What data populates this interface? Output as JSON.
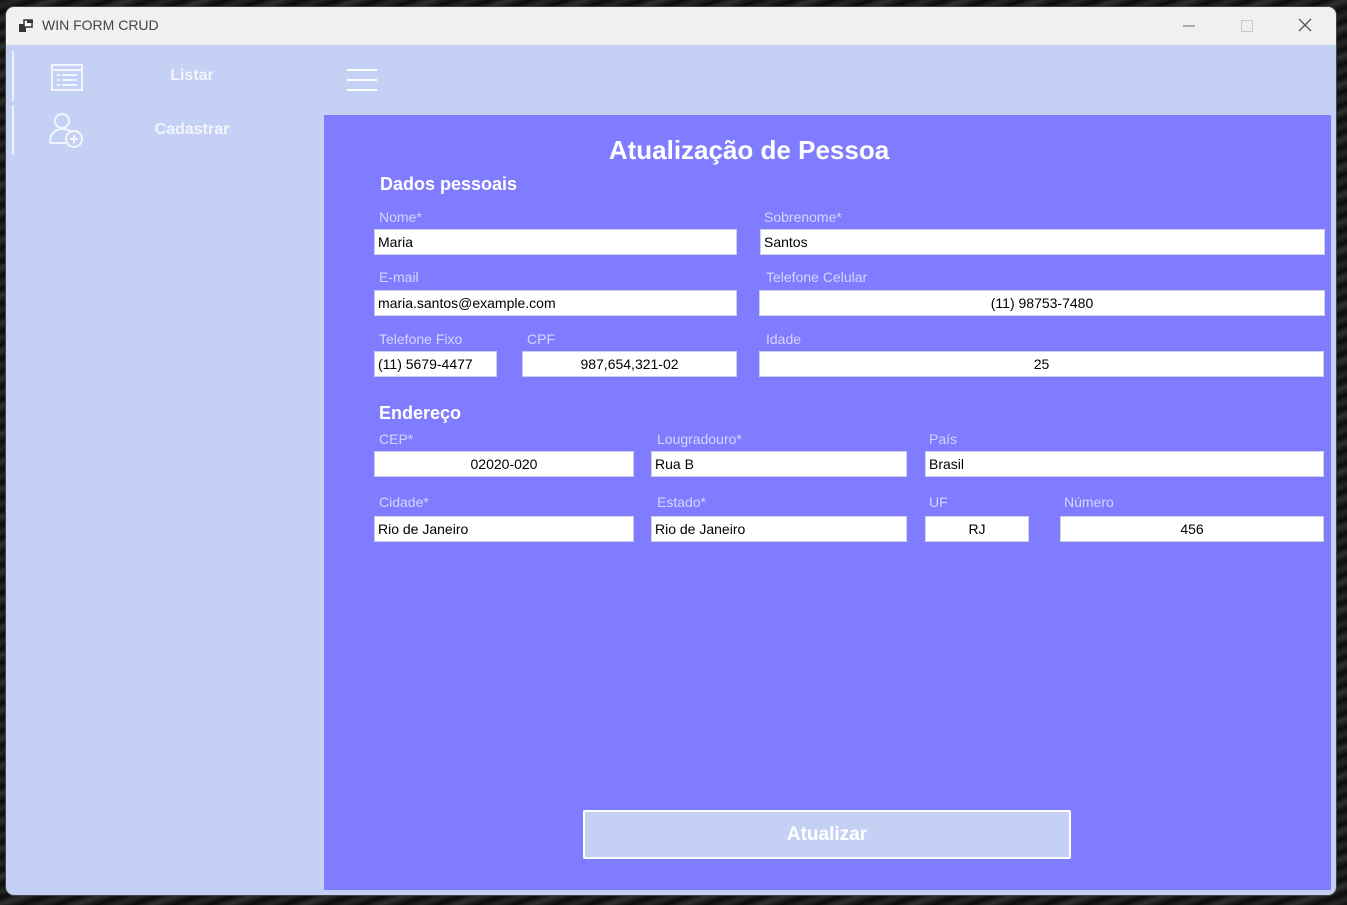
{
  "window": {
    "title": "WIN FORM CRUD",
    "icon": "app-window-icon"
  },
  "titlebar_buttons": [
    "minimize-icon",
    "maximize-icon",
    "close-icon"
  ],
  "sidebar": {
    "items": [
      {
        "label": "Listar",
        "icon": "list-icon"
      },
      {
        "label": "Cadastrar",
        "icon": "add-user-icon"
      }
    ]
  },
  "toolbar": {
    "menu_icon": "hamburger-menu-icon"
  },
  "form": {
    "title": "Atualização de Pessoa",
    "personal_section": "Dados pessoais",
    "address_section": "Endereço",
    "fields": {
      "nome": {
        "label": "Nome*",
        "value": "Maria"
      },
      "sobrenome": {
        "label": "Sobrenome*",
        "value": "Santos"
      },
      "email": {
        "label": "E-mail",
        "value": "maria.santos@example.com"
      },
      "celular": {
        "label": "Telefone Celular",
        "value": "(11) 98753-7480"
      },
      "fixo": {
        "label": "Telefone Fixo",
        "value": "(11) 5679-4477"
      },
      "cpf": {
        "label": "CPF",
        "value": "987,654,321-02"
      },
      "idade": {
        "label": "Idade",
        "value": "25"
      },
      "cep": {
        "label": "CEP*",
        "value": "02020-020"
      },
      "logradouro": {
        "label": "Lougradouro*",
        "value": "Rua B"
      },
      "pais": {
        "label": "País",
        "value": "Brasil"
      },
      "cidade": {
        "label": "Cidade*",
        "value": "Rio de Janeiro"
      },
      "estado": {
        "label": "Estado*",
        "value": "Rio de Janeiro"
      },
      "uf": {
        "label": "UF",
        "value": "RJ"
      },
      "numero": {
        "label": "Número",
        "value": "456"
      }
    },
    "submit_label": "Atualizar"
  },
  "colors": {
    "sidebar_bg": "#c4d1f4",
    "content_bg": "#807cff",
    "field_label": "#d6d4ff",
    "titlebar_bg": "#f0f0f0"
  }
}
